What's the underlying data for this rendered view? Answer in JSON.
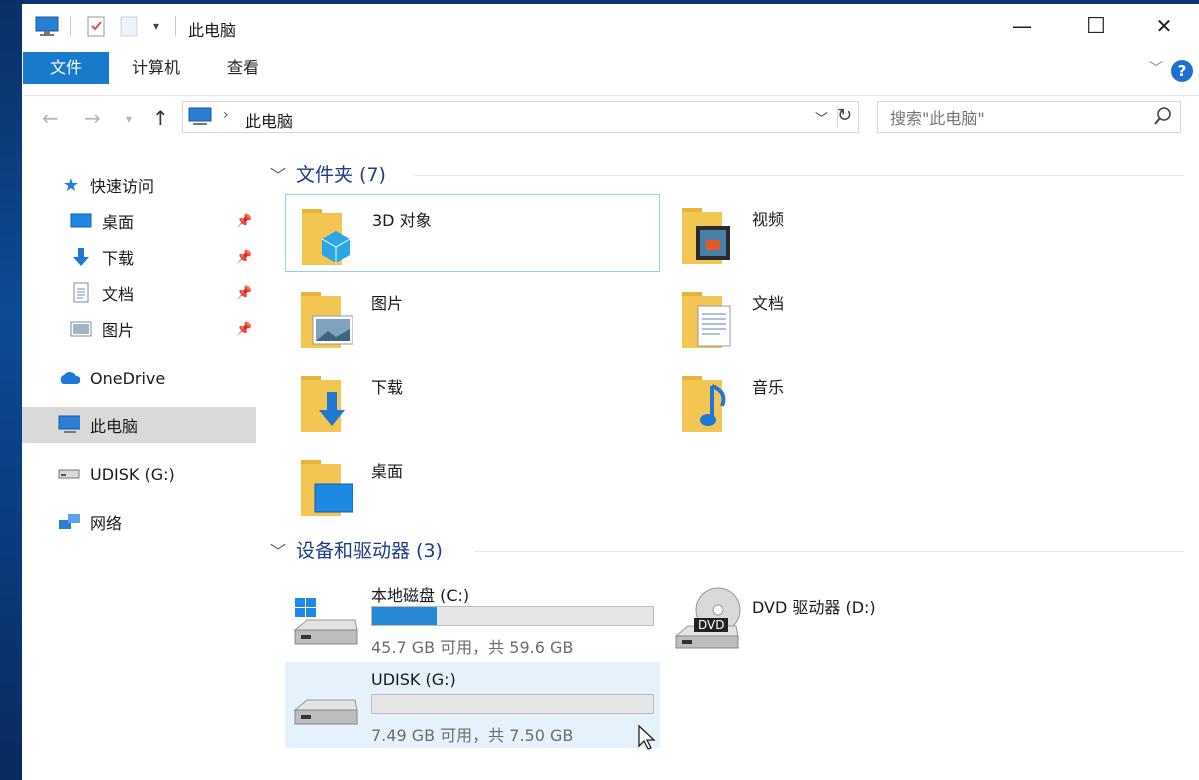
{
  "window": {
    "title": "此电脑",
    "controls": {
      "minimize": "—",
      "maximize": "☐",
      "close": "✕"
    }
  },
  "ribbon": {
    "tabs": [
      "文件",
      "计算机",
      "查看"
    ],
    "help": "?"
  },
  "address": {
    "path": "此电脑",
    "search_placeholder": "搜索\"此电脑\""
  },
  "nav": {
    "quick_access": "快速访问",
    "pinned": [
      "桌面",
      "下载",
      "文档",
      "图片"
    ],
    "onedrive": "OneDrive",
    "this_pc": "此电脑",
    "udisk": "UDISK (G:)",
    "network": "网络"
  },
  "folders": {
    "heading": "文件夹 (7)",
    "items": [
      "3D 对象",
      "视频",
      "图片",
      "文档",
      "下载",
      "音乐",
      "桌面"
    ]
  },
  "drives": {
    "heading": "设备和驱动器 (3)",
    "items": [
      {
        "name": "本地磁盘 (C:)",
        "space": "45.7 GB 可用，共 59.6 GB",
        "used_fraction": 0.23
      },
      {
        "name": "DVD 驱动器 (D:)",
        "badge": "DVD"
      },
      {
        "name": "UDISK (G:)",
        "space": "7.49 GB 可用，共 7.50 GB",
        "used_fraction": 0.0
      }
    ]
  },
  "colors": {
    "accent": "#1979ca",
    "folder": "#f3c552",
    "bar": "#2688d6"
  }
}
